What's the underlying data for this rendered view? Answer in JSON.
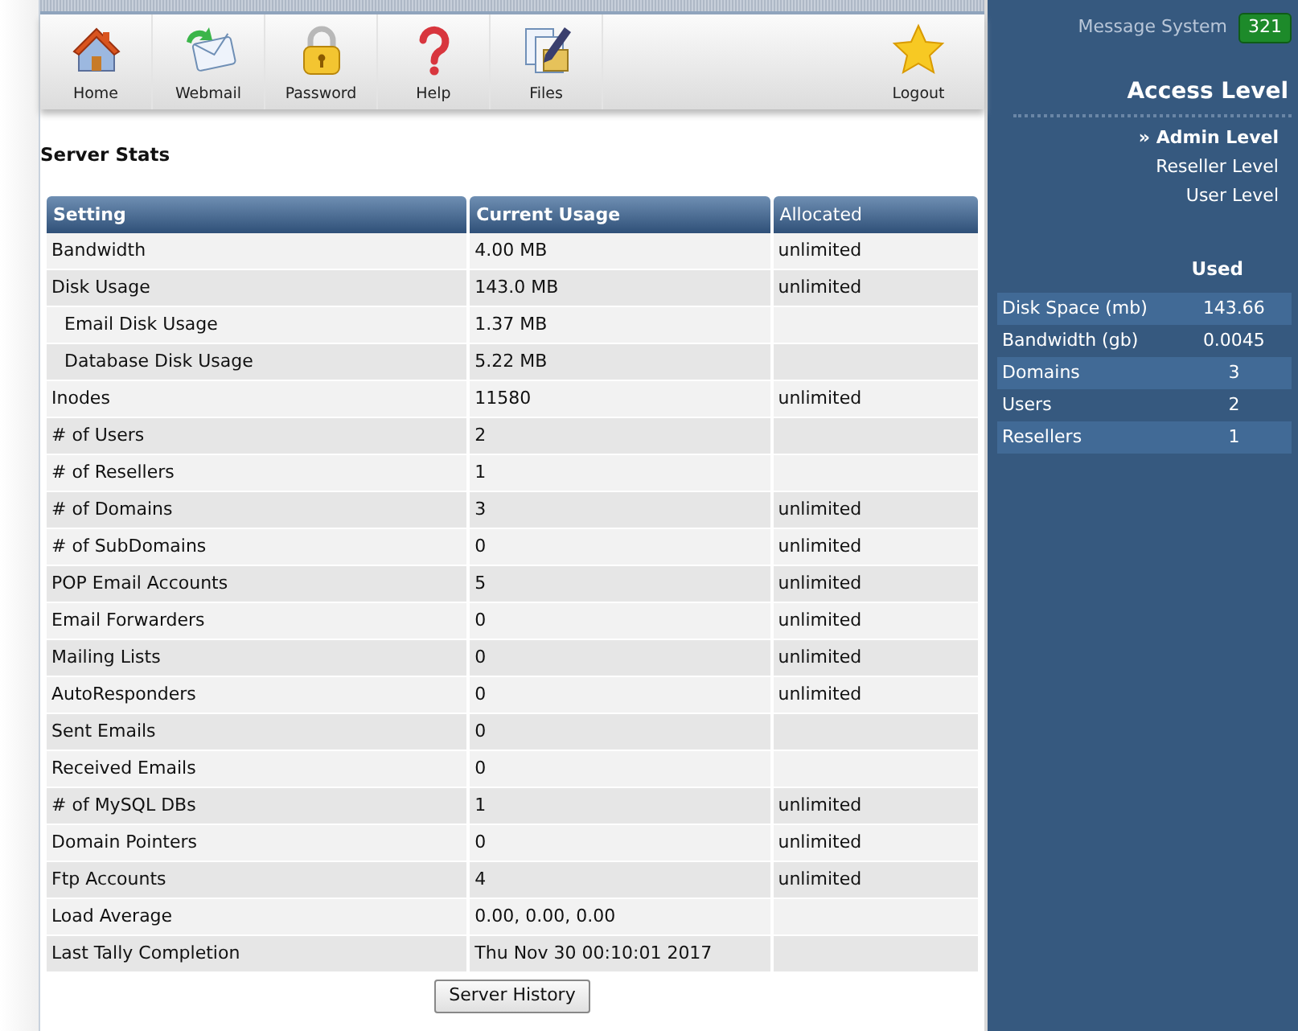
{
  "toolbar": [
    {
      "label": "Home",
      "kind": "home"
    },
    {
      "label": "Webmail",
      "kind": "mail"
    },
    {
      "label": "Password",
      "kind": "lock"
    },
    {
      "label": "Help",
      "kind": "help"
    },
    {
      "label": "Files",
      "kind": "files"
    },
    {
      "label": "Logout",
      "kind": "logout"
    }
  ],
  "page_title": "Server Stats",
  "table": {
    "columns": [
      "Setting",
      "Current Usage",
      "Allocated"
    ],
    "rows": [
      {
        "setting": "Bandwidth",
        "usage": "4.00 MB",
        "allocated": "unlimited"
      },
      {
        "setting": "Disk Usage",
        "usage": "143.0 MB",
        "allocated": "unlimited",
        "children": [
          {
            "setting": "Email Disk Usage",
            "usage": "1.37 MB"
          },
          {
            "setting": "Database Disk Usage",
            "usage": "5.22 MB"
          }
        ]
      },
      {
        "setting": "Inodes",
        "usage": "11580",
        "allocated": "unlimited"
      },
      {
        "setting": "# of Users",
        "usage": "2"
      },
      {
        "setting": "# of Resellers",
        "usage": "1"
      },
      {
        "setting": "# of Domains",
        "usage": "3",
        "allocated": "unlimited"
      },
      {
        "setting": "# of SubDomains",
        "usage": "0",
        "allocated": "unlimited"
      },
      {
        "setting": "POP Email Accounts",
        "usage": "5",
        "allocated": "unlimited"
      },
      {
        "setting": "Email Forwarders",
        "usage": "0",
        "allocated": "unlimited"
      },
      {
        "setting": "Mailing Lists",
        "usage": "0",
        "allocated": "unlimited"
      },
      {
        "setting": "AutoResponders",
        "usage": "0",
        "allocated": "unlimited"
      },
      {
        "setting": "Sent Emails",
        "usage": "0"
      },
      {
        "setting": "Received Emails",
        "usage": "0"
      },
      {
        "setting": "# of MySQL DBs",
        "usage": "1",
        "allocated": "unlimited"
      },
      {
        "setting": "Domain Pointers",
        "usage": "0",
        "allocated": "unlimited"
      },
      {
        "setting": "Ftp Accounts",
        "usage": "4",
        "allocated": "unlimited"
      },
      {
        "setting": "Load Average",
        "usage": "0.00, 0.00, 0.00"
      },
      {
        "setting": "Last Tally Completion",
        "usage": "Thu Nov 30 00:10:01 2017"
      }
    ]
  },
  "history_button": "Server History",
  "sidebar": {
    "message_system": {
      "label": "Message System",
      "count": "321"
    },
    "access_title": "Access Level",
    "selected_marker": "»",
    "levels": [
      {
        "label": "Admin Level",
        "selected": true
      },
      {
        "label": "Reseller Level",
        "selected": false
      },
      {
        "label": "User Level",
        "selected": false
      }
    ],
    "used_heading": "Used",
    "used": [
      {
        "label": "Disk Space (mb)",
        "value": "143.66"
      },
      {
        "label": "Bandwidth (gb)",
        "value": "0.0045"
      },
      {
        "label": "Domains",
        "value": "3"
      },
      {
        "label": "Users",
        "value": "2"
      },
      {
        "label": "Resellers",
        "value": "1"
      }
    ]
  }
}
